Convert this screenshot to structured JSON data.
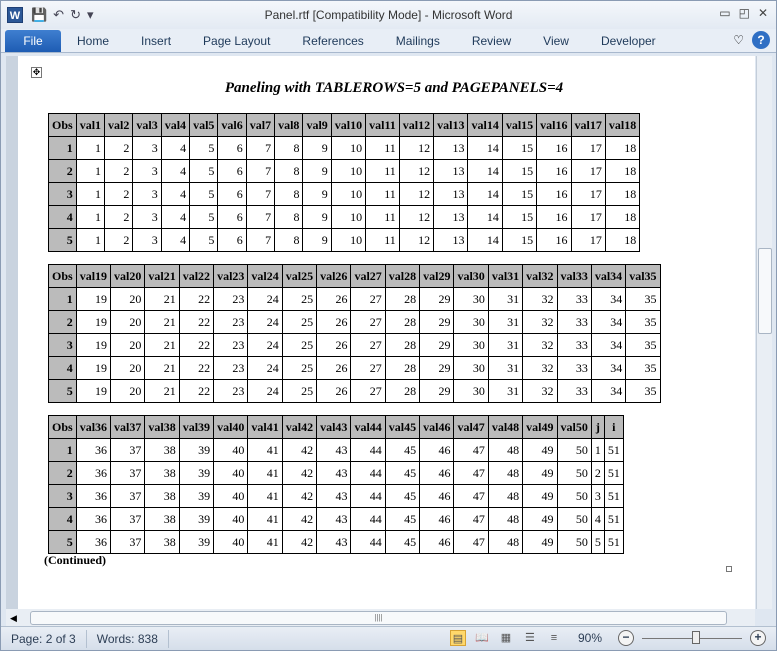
{
  "window": {
    "title": "Panel.rtf [Compatibility Mode]  -  Microsoft Word"
  },
  "ribbon": {
    "tabs": [
      "File",
      "Home",
      "Insert",
      "Page Layout",
      "References",
      "Mailings",
      "Review",
      "View",
      "Developer"
    ]
  },
  "document": {
    "heading": "Paneling with TABLEROWS=5 and PAGEPANELS=4",
    "continued": "(Continued)",
    "panels": [
      {
        "headers": [
          "Obs",
          "val1",
          "val2",
          "val3",
          "val4",
          "val5",
          "val6",
          "val7",
          "val8",
          "val9",
          "val10",
          "val11",
          "val12",
          "val13",
          "val14",
          "val15",
          "val16",
          "val17",
          "val18"
        ],
        "rows": [
          [
            1,
            1,
            2,
            3,
            4,
            5,
            6,
            7,
            8,
            9,
            10,
            11,
            12,
            13,
            14,
            15,
            16,
            17,
            18
          ],
          [
            2,
            1,
            2,
            3,
            4,
            5,
            6,
            7,
            8,
            9,
            10,
            11,
            12,
            13,
            14,
            15,
            16,
            17,
            18
          ],
          [
            3,
            1,
            2,
            3,
            4,
            5,
            6,
            7,
            8,
            9,
            10,
            11,
            12,
            13,
            14,
            15,
            16,
            17,
            18
          ],
          [
            4,
            1,
            2,
            3,
            4,
            5,
            6,
            7,
            8,
            9,
            10,
            11,
            12,
            13,
            14,
            15,
            16,
            17,
            18
          ],
          [
            5,
            1,
            2,
            3,
            4,
            5,
            6,
            7,
            8,
            9,
            10,
            11,
            12,
            13,
            14,
            15,
            16,
            17,
            18
          ]
        ]
      },
      {
        "headers": [
          "Obs",
          "val19",
          "val20",
          "val21",
          "val22",
          "val23",
          "val24",
          "val25",
          "val26",
          "val27",
          "val28",
          "val29",
          "val30",
          "val31",
          "val32",
          "val33",
          "val34",
          "val35"
        ],
        "rows": [
          [
            1,
            19,
            20,
            21,
            22,
            23,
            24,
            25,
            26,
            27,
            28,
            29,
            30,
            31,
            32,
            33,
            34,
            35
          ],
          [
            2,
            19,
            20,
            21,
            22,
            23,
            24,
            25,
            26,
            27,
            28,
            29,
            30,
            31,
            32,
            33,
            34,
            35
          ],
          [
            3,
            19,
            20,
            21,
            22,
            23,
            24,
            25,
            26,
            27,
            28,
            29,
            30,
            31,
            32,
            33,
            34,
            35
          ],
          [
            4,
            19,
            20,
            21,
            22,
            23,
            24,
            25,
            26,
            27,
            28,
            29,
            30,
            31,
            32,
            33,
            34,
            35
          ],
          [
            5,
            19,
            20,
            21,
            22,
            23,
            24,
            25,
            26,
            27,
            28,
            29,
            30,
            31,
            32,
            33,
            34,
            35
          ]
        ]
      },
      {
        "headers": [
          "Obs",
          "val36",
          "val37",
          "val38",
          "val39",
          "val40",
          "val41",
          "val42",
          "val43",
          "val44",
          "val45",
          "val46",
          "val47",
          "val48",
          "val49",
          "val50",
          "j",
          "i"
        ],
        "rows": [
          [
            1,
            36,
            37,
            38,
            39,
            40,
            41,
            42,
            43,
            44,
            45,
            46,
            47,
            48,
            49,
            50,
            1,
            51
          ],
          [
            2,
            36,
            37,
            38,
            39,
            40,
            41,
            42,
            43,
            44,
            45,
            46,
            47,
            48,
            49,
            50,
            2,
            51
          ],
          [
            3,
            36,
            37,
            38,
            39,
            40,
            41,
            42,
            43,
            44,
            45,
            46,
            47,
            48,
            49,
            50,
            3,
            51
          ],
          [
            4,
            36,
            37,
            38,
            39,
            40,
            41,
            42,
            43,
            44,
            45,
            46,
            47,
            48,
            49,
            50,
            4,
            51
          ],
          [
            5,
            36,
            37,
            38,
            39,
            40,
            41,
            42,
            43,
            44,
            45,
            46,
            47,
            48,
            49,
            50,
            5,
            51
          ]
        ]
      }
    ]
  },
  "status": {
    "page": "Page: 2 of 3",
    "words": "Words: 838",
    "zoom": "90%",
    "zoom_percent": 90
  }
}
